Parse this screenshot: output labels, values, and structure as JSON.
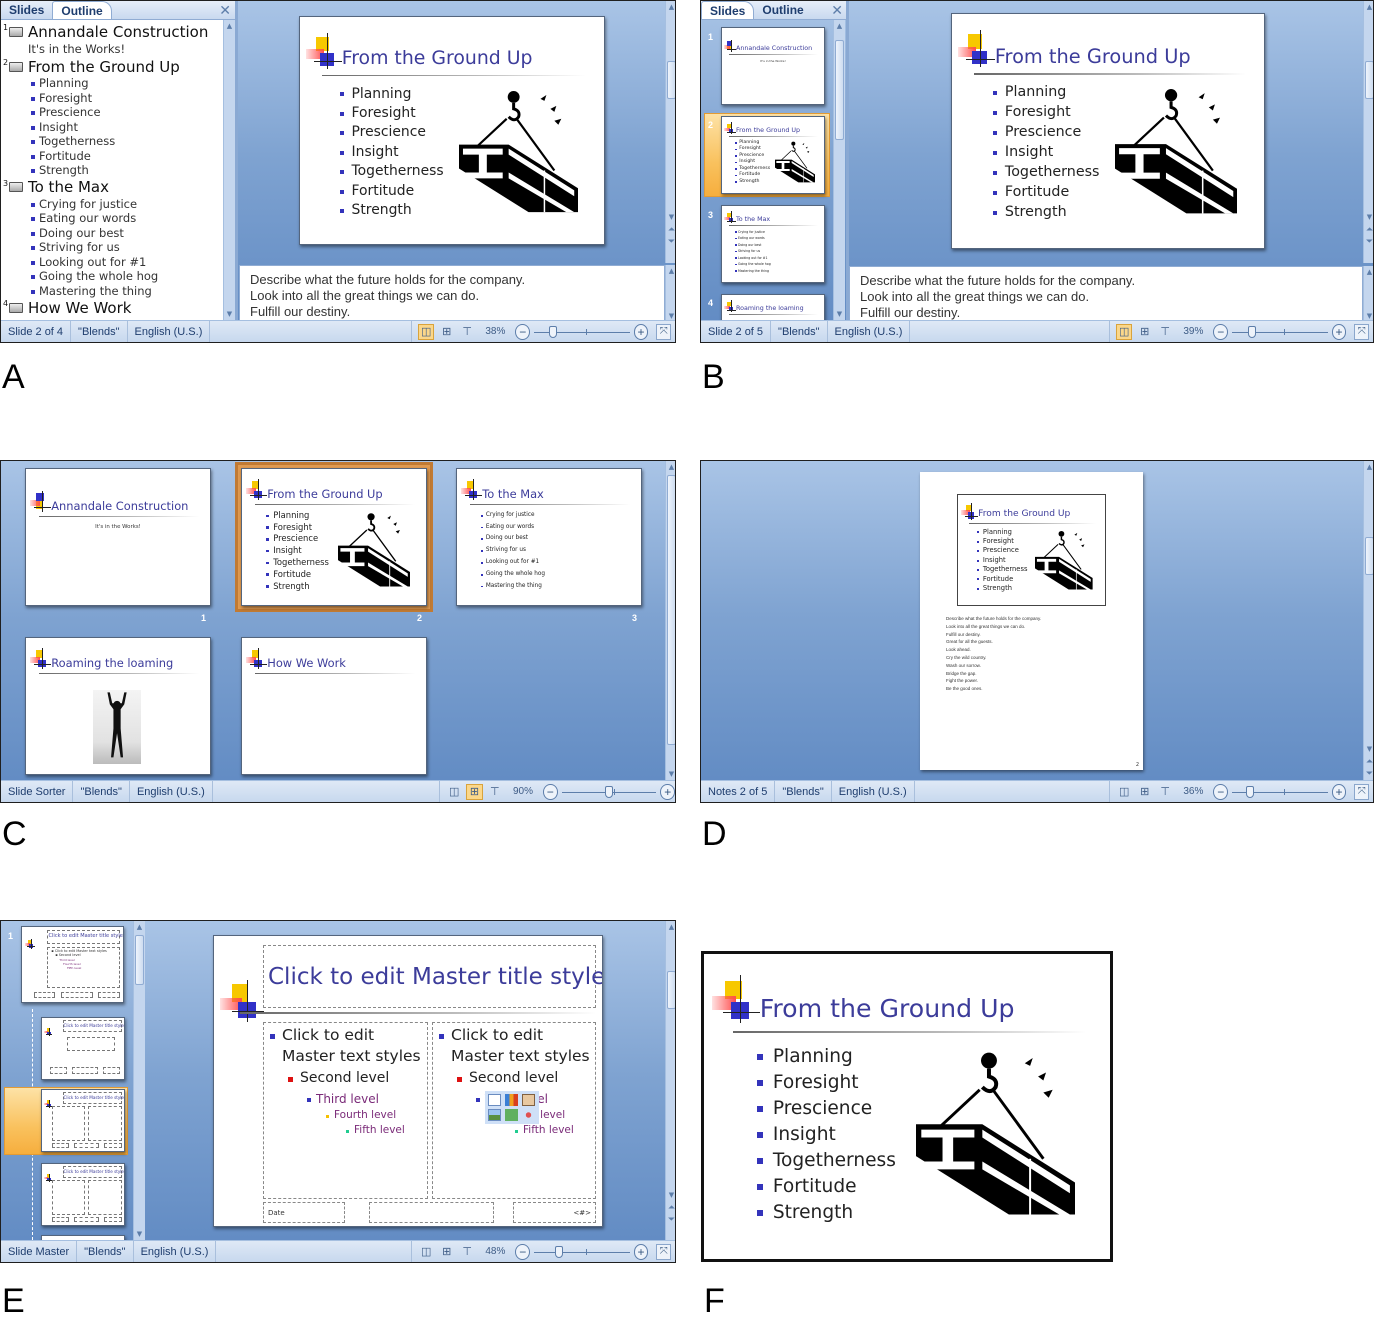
{
  "panel_labels": [
    "A",
    "B",
    "C",
    "D",
    "E",
    "F"
  ],
  "common": {
    "theme": "\"Blends\"",
    "language": "English (U.S.)",
    "pane_tabs": {
      "slides": "Slides",
      "outline": "Outline"
    },
    "view_buttons": [
      "normal-view",
      "slide-sorter-view",
      "slide-show-view"
    ]
  },
  "slide2": {
    "title": "From the Ground Up",
    "bullets": [
      "Planning",
      "Foresight",
      "Prescience",
      "Insight",
      "Togetherness",
      "Fortitude",
      "Strength"
    ]
  },
  "slides": [
    {
      "num": "1",
      "title": "Annandale Construction",
      "subtitle": "It's in the Works!"
    },
    {
      "num": "2",
      "title": "From the Ground Up",
      "bullets": [
        "Planning",
        "Foresight",
        "Prescience",
        "Insight",
        "Togetherness",
        "Fortitude",
        "Strength"
      ]
    },
    {
      "num": "3",
      "title": "To the Max",
      "bullets": [
        "Crying for justice",
        "Eating our words",
        "Doing our best",
        "Striving for us",
        "Looking out for #1",
        "Going the whole hog",
        "Mastering the thing"
      ]
    },
    {
      "num": "4",
      "title": "Roaming the loaming"
    },
    {
      "num": "5",
      "title": "How We Work"
    }
  ],
  "panelA": {
    "outline": [
      {
        "num": "1",
        "title": "Annandale Construction",
        "subtitle": "It's in the Works!"
      },
      {
        "num": "2",
        "title": "From the Ground Up",
        "bullets": [
          "Planning",
          "Foresight",
          "Prescience",
          "Insight",
          "Togetherness",
          "Fortitude",
          "Strength"
        ]
      },
      {
        "num": "3",
        "title": "To the Max",
        "bullets": [
          "Crying for justice",
          "Eating our words",
          "Doing our best",
          "Striving for us",
          "Looking out for #1",
          "Going the whole hog",
          "Mastering the thing"
        ]
      },
      {
        "num": "4",
        "title": "How We Work"
      }
    ],
    "notes": [
      "Describe what the future holds for the company.",
      "Look into all the great things we can do.",
      "Fulfill our destiny."
    ],
    "status": "Slide 2 of 4",
    "zoom": "38%",
    "zoom_level_percent": 38
  },
  "panelB": {
    "thumb_titles": [
      "Annandale Construction",
      "From the Ground Up",
      "To the Max",
      "Roaming the loaming"
    ],
    "thumb_sub": "It's in the Works!",
    "selected_slide": "2",
    "notes": [
      "Describe what the future holds for the company.",
      "Look into all the great things we can do.",
      "Fulfill our destiny."
    ],
    "status": "Slide 2 of 5",
    "zoom": "39%",
    "zoom_level_percent": 39
  },
  "panelC": {
    "status": "Slide Sorter",
    "zoom": "90%",
    "zoom_level_percent": 90,
    "selected_slide": "2"
  },
  "panelD": {
    "notes_lines": [
      "Describe what the future holds for the company.",
      "Look into all the great things we can do.",
      "Fulfill our destiny.",
      "Great for all the guests.",
      "Look ahead.",
      "Cry the wild country.",
      "Wash our sorrow.",
      "Bridge the gap.",
      "Fight the power.",
      "Be the good ones."
    ],
    "page_number": "2",
    "status": "Notes 2 of 5",
    "zoom": "36%",
    "zoom_level_percent": 36
  },
  "panelE": {
    "master_title": "Click to edit Master title style",
    "level1_line1": "Click to edit",
    "level1_line2": "Master text styles",
    "level2": "Second level",
    "level3": "Third level",
    "level4": "Fourth level",
    "level5": "Fifth level",
    "footer_date": "Date",
    "footer_num": "<#>",
    "thumb_title": "Click to edit Master title style",
    "status": "Slide Master",
    "zoom": "48%",
    "zoom_level_percent": 48
  }
}
